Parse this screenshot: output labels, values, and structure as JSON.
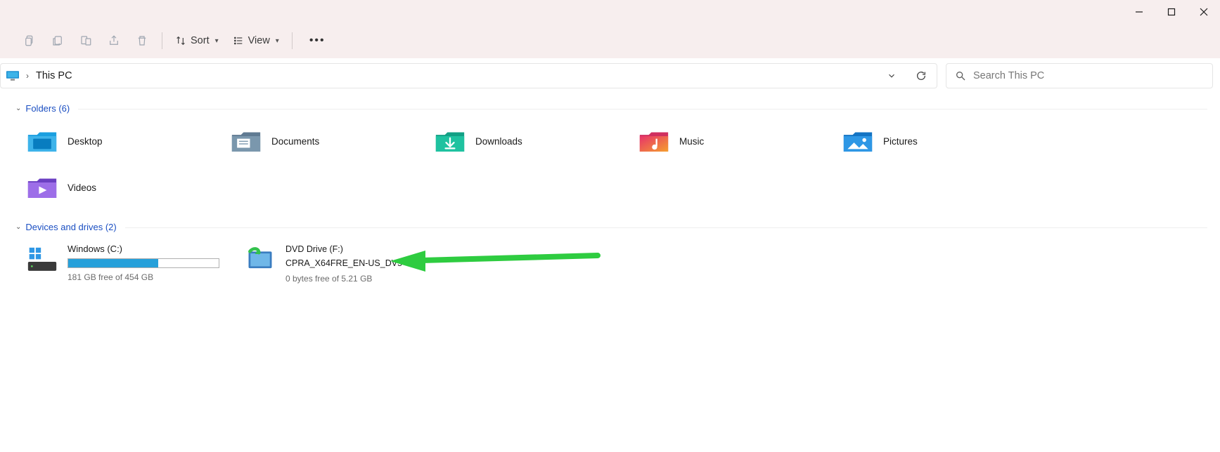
{
  "toolbar": {
    "sort_label": "Sort",
    "view_label": "View"
  },
  "breadcrumb": {
    "location": "This PC"
  },
  "search": {
    "placeholder": "Search This PC"
  },
  "sections": {
    "folders": {
      "label": "Folders (6)",
      "items": [
        {
          "label": "Desktop"
        },
        {
          "label": "Documents"
        },
        {
          "label": "Downloads"
        },
        {
          "label": "Music"
        },
        {
          "label": "Pictures"
        },
        {
          "label": "Videos"
        }
      ]
    },
    "drives": {
      "label": "Devices and drives (2)",
      "items": [
        {
          "title": "Windows (C:)",
          "subtitle": "181 GB free of 454 GB",
          "fill_percent": 60
        },
        {
          "line1": "DVD Drive (F:)",
          "line2": "CPRA_X64FRE_EN-US_DV5",
          "subtitle": "0 bytes free of 5.21 GB"
        }
      ]
    }
  }
}
